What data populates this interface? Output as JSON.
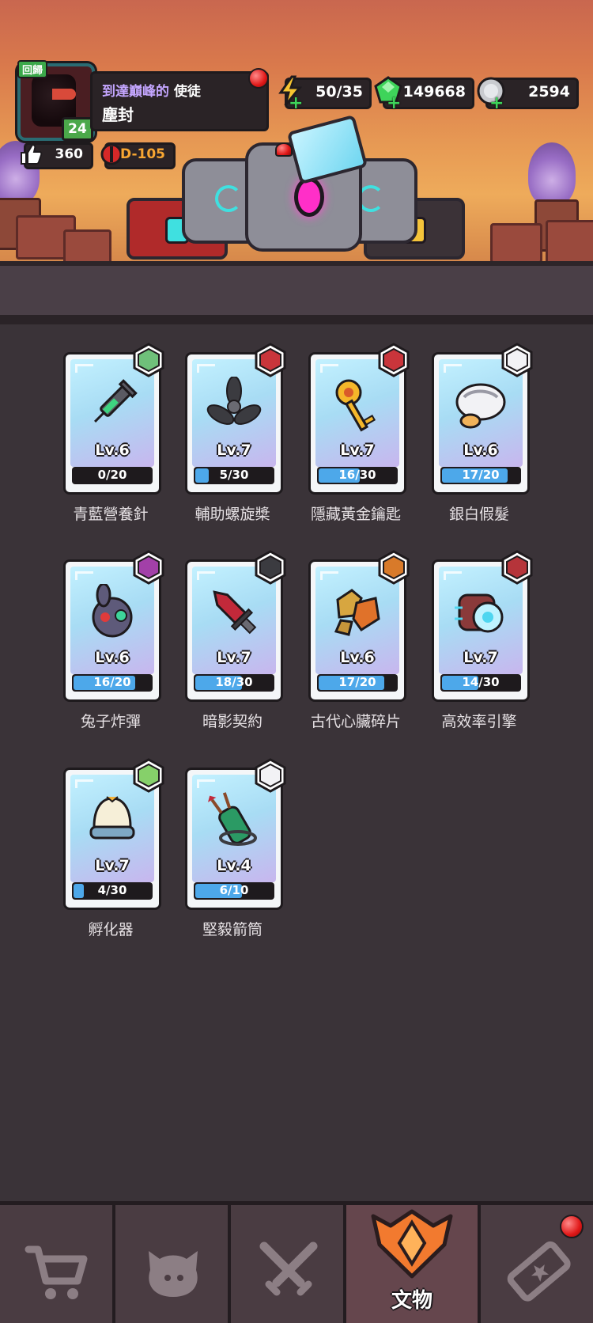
{
  "player": {
    "return_badge": "回歸",
    "level": "24",
    "title": "到達巔峰的",
    "role": "使徒",
    "name": "塵封",
    "likes": "360",
    "stage": "D-105"
  },
  "resources": {
    "energy": "50/35",
    "gems": "149668",
    "coins": "2594"
  },
  "artifacts": [
    {
      "name": "青藍營養針",
      "level": "Lv.6",
      "progress": "0/20",
      "fill": 0.0,
      "icon": "syringe-icon",
      "hex": "rabbit-hero-icon"
    },
    {
      "name": "輔助螺旋槳",
      "level": "Lv.7",
      "progress": "5/30",
      "fill": 0.17,
      "icon": "propeller-icon",
      "hex": "drone-hero-icon"
    },
    {
      "name": "隱藏黃金鑰匙",
      "level": "Lv.7",
      "progress": "16/30",
      "fill": 0.53,
      "icon": "golden-key-icon",
      "hex": "chest-hero-icon"
    },
    {
      "name": "銀白假髮",
      "level": "Lv.6",
      "progress": "17/20",
      "fill": 0.85,
      "icon": "wig-icon",
      "hex": "duck-hero-icon"
    },
    {
      "name": "兔子炸彈",
      "level": "Lv.6",
      "progress": "16/20",
      "fill": 0.8,
      "icon": "bunny-bomb-icon",
      "hex": "jester-hero-icon"
    },
    {
      "name": "暗影契約",
      "level": "Lv.7",
      "progress": "18/30",
      "fill": 0.6,
      "icon": "dagger-icon",
      "hex": "plague-hero-icon"
    },
    {
      "name": "古代心臟碎片",
      "level": "Lv.6",
      "progress": "17/20",
      "fill": 0.85,
      "icon": "heart-shard-icon",
      "hex": "monkey-hero-icon"
    },
    {
      "name": "高效率引擎",
      "level": "Lv.7",
      "progress": "14/30",
      "fill": 0.47,
      "icon": "engine-icon",
      "hex": "robot-hero-icon"
    },
    {
      "name": "孵化器",
      "level": "Lv.7",
      "progress": "4/30",
      "fill": 0.13,
      "icon": "incubator-icon",
      "hex": "egg-hero-icon"
    },
    {
      "name": "堅毅箭筒",
      "level": "Lv.4",
      "progress": "6/10",
      "fill": 0.6,
      "icon": "quiver-icon",
      "hex": "archer-hero-icon"
    }
  ],
  "nav": {
    "tabs": [
      {
        "icon": "cart-icon",
        "label": ""
      },
      {
        "icon": "pet-icon",
        "label": ""
      },
      {
        "icon": "swords-icon",
        "label": ""
      },
      {
        "icon": "artifact-emblem-icon",
        "label": "文物"
      },
      {
        "icon": "ticket-icon",
        "label": ""
      }
    ]
  },
  "colors": {
    "accent": "#4da8ea",
    "background": "#3a3338",
    "nav_active": "#65464d"
  }
}
